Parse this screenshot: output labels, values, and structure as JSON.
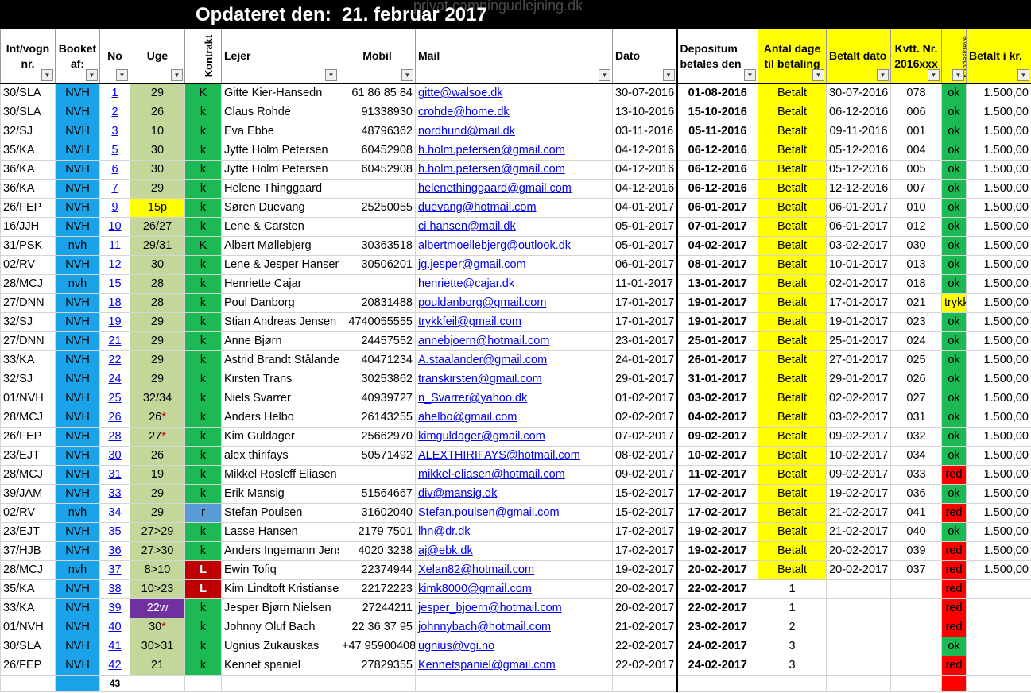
{
  "header": {
    "title": "Opdateret den:  21. februar 2017",
    "watermark": "privat.campingudlejning.dk"
  },
  "columns": {
    "int": "Int/vogn nr.",
    "booket": "Booket af:",
    "no": "No",
    "uge": "Uge",
    "kontrakt": "Kontrakt",
    "lejer": "Lejer",
    "mobil": "Mobil",
    "mail": "Mail",
    "dato": "Dato",
    "depositum": "Depositum betales den",
    "antal": "Antal dage til betaling",
    "betalt_dato": "Betalt dato",
    "kvtt": "Kvtt. Nr. 2016xxx",
    "kundeskreve": "Kundeskreve",
    "betalt_kr": "Betalt i kr."
  },
  "filter_icon": "dropdown-arrow-icon",
  "rows": [
    {
      "int": "30/SLA",
      "booket": "NVH",
      "no": "1",
      "uge": "29",
      "kontrakt": "K",
      "lejer": "Gitte Kier-Hansedn",
      "mobil": "61 86 85 84",
      "mail": "gitte@walsoe.dk",
      "dato": "30-07-2016",
      "depositum": "01-08-2016",
      "antal": "Betalt",
      "betalt_dato": "30-07-2016",
      "kvtt": "078",
      "status": "ok",
      "kr": "1.500,00"
    },
    {
      "int": "30/SLA",
      "booket": "NVH",
      "no": "2",
      "uge": "26",
      "kontrakt": "k",
      "lejer": "Claus Rohde",
      "mobil": "91338930",
      "mail": "crohde@home.dk",
      "dato": "13-10-2016",
      "depositum": "15-10-2016",
      "antal": "Betalt",
      "betalt_dato": "06-12-2016",
      "kvtt": "006",
      "status": "ok",
      "kr": "1.500,00"
    },
    {
      "int": "32/SJ",
      "booket": "NVH",
      "no": "3",
      "uge": "10",
      "kontrakt": "k",
      "lejer": "Eva Ebbe",
      "mobil": "48796362",
      "mail": "nordhund@mail.dk",
      "dato": "03-11-2016",
      "depositum": "05-11-2016",
      "antal": "Betalt",
      "betalt_dato": "09-11-2016",
      "kvtt": "001",
      "status": "ok",
      "kr": "1.500,00"
    },
    {
      "int": "35/KA",
      "booket": "NVH",
      "no": "5",
      "uge": "30",
      "kontrakt": "k",
      "lejer": "Jytte Holm Petersen",
      "mobil": "60452908",
      "mail": "h.holm.petersen@gmail.com",
      "dato": "04-12-2016",
      "depositum": "06-12-2016",
      "antal": "Betalt",
      "betalt_dato": "05-12-2016",
      "kvtt": "004",
      "status": "ok",
      "kr": "1.500,00"
    },
    {
      "int": "36/KA",
      "booket": "NVH",
      "no": "6",
      "uge": "30",
      "kontrakt": "k",
      "lejer": "Jytte Holm Petersen",
      "mobil": "60452908",
      "mail": "h.holm.petersen@gmail.com",
      "dato": "04-12-2016",
      "depositum": "06-12-2016",
      "antal": "Betalt",
      "betalt_dato": "05-12-2016",
      "kvtt": "005",
      "status": "ok",
      "kr": "1.500,00"
    },
    {
      "int": "36/KA",
      "booket": "NVH",
      "no": "7",
      "uge": "29",
      "kontrakt": "k",
      "lejer": "Helene Thinggaard",
      "mobil": "",
      "mail": "helenethinggaard@gmail.com",
      "dato": "04-12-2016",
      "depositum": "06-12-2016",
      "antal": "Betalt",
      "betalt_dato": "12-12-2016",
      "kvtt": "007",
      "status": "ok",
      "kr": "1.500,00"
    },
    {
      "int": "26/FEP",
      "booket": "NVH",
      "no": "9",
      "uge": "15p",
      "uge_style": "yellow",
      "kontrakt": "k",
      "lejer": "Søren Duevang",
      "mobil": "25250055",
      "mail": "duevang@hotmail.com",
      "dato": "04-01-2017",
      "depositum": "06-01-2017",
      "antal": "Betalt",
      "betalt_dato": "06-01-2017",
      "kvtt": "010",
      "status": "ok",
      "kr": "1.500,00"
    },
    {
      "int": "16/JJH",
      "booket": "NVH",
      "no": "10",
      "uge": "26/27",
      "kontrakt": "k",
      "lejer": "Lene & Carsten",
      "mobil": "",
      "mail": "ci.hansen@mail.dk",
      "dato": "05-01-2017",
      "depositum": "07-01-2017",
      "antal": "Betalt",
      "betalt_dato": "06-01-2017",
      "kvtt": "012",
      "status": "ok",
      "kr": "1.500,00"
    },
    {
      "int": "31/PSK",
      "booket": "nvh",
      "no": "11",
      "uge": "29/31",
      "kontrakt": "K",
      "lejer": "Albert Møllebjerg",
      "mobil": "30363518",
      "mail": "albertmoellebjerg@outlook.dk",
      "dato": "05-01-2017",
      "depositum": "04-02-2017",
      "antal": "Betalt",
      "betalt_dato": "03-02-2017",
      "kvtt": "030",
      "status": "ok",
      "kr": "1.500,00"
    },
    {
      "int": "02/RV",
      "booket": "NVH",
      "no": "12",
      "uge": "30",
      "kontrakt": "k",
      "lejer": "Lene & Jesper Hansen",
      "mobil": "30506201",
      "mail": "jg.jesper@gmail.com",
      "dato": "06-01-2017",
      "depositum": "08-01-2017",
      "antal": "Betalt",
      "betalt_dato": "10-01-2017",
      "kvtt": "013",
      "status": "ok",
      "kr": "1.500,00"
    },
    {
      "int": "28/MCJ",
      "booket": "nvh",
      "no": "15",
      "uge": "28",
      "kontrakt": "k",
      "lejer": "Henriette Cajar",
      "mobil": "",
      "mail": "henriette@cajar.dk",
      "dato": "11-01-2017",
      "depositum": "13-01-2017",
      "antal": "Betalt",
      "betalt_dato": "02-01-2017",
      "kvtt": "018",
      "status": "ok",
      "kr": "1.500,00"
    },
    {
      "int": "27/DNN",
      "booket": "NVH",
      "no": "18",
      "uge": "28",
      "kontrakt": "k",
      "lejer": "Poul Danborg",
      "mobil": "20831488",
      "mail": "pouldanborg@gmail.com",
      "dato": "17-01-2017",
      "depositum": "19-01-2017",
      "antal": "Betalt",
      "betalt_dato": "17-01-2017",
      "kvtt": "021",
      "status": "trykkeri",
      "kr": "1.500,00"
    },
    {
      "int": "32/SJ",
      "booket": "NVH",
      "no": "19",
      "uge": "29",
      "kontrakt": "k",
      "lejer": "Stian Andreas Jensen",
      "mobil": "4740055555",
      "mail": "trykkfeil@gmail.com",
      "dato": "17-01-2017",
      "depositum": "19-01-2017",
      "antal": "Betalt",
      "betalt_dato": "19-01-2017",
      "kvtt": "023",
      "status": "ok",
      "kr": "1.500,00"
    },
    {
      "int": "27/DNN",
      "booket": "NVH",
      "no": "21",
      "uge": "29",
      "kontrakt": "k",
      "lejer": "Anne Bjørn",
      "mobil": "24457552",
      "mail": "annebjoern@hotmail.com",
      "dato": "23-01-2017",
      "depositum": "25-01-2017",
      "antal": "Betalt",
      "betalt_dato": "25-01-2017",
      "kvtt": "024",
      "status": "ok",
      "kr": "1.500,00"
    },
    {
      "int": "33/KA",
      "booket": "NVH",
      "no": "22",
      "uge": "29",
      "kontrakt": "k",
      "lejer": "Astrid Brandt Stålande",
      "mobil": "40471234",
      "mail": "A.staalander@gmail.com",
      "dato": "24-01-2017",
      "depositum": "26-01-2017",
      "antal": "Betalt",
      "betalt_dato": "27-01-2017",
      "kvtt": "025",
      "status": "ok",
      "kr": "1.500,00"
    },
    {
      "int": "32/SJ",
      "booket": "NVH",
      "no": "24",
      "uge": "29",
      "kontrakt": "k",
      "lejer": "Kirsten Trans",
      "mobil": "30253862",
      "mail": "transkirsten@gmail.com",
      "dato": "29-01-2017",
      "depositum": "31-01-2017",
      "antal": "Betalt",
      "betalt_dato": "29-01-2017",
      "kvtt": "026",
      "status": "ok",
      "kr": "1.500,00"
    },
    {
      "int": "01/NVH",
      "booket": "NVH",
      "no": "25",
      "uge": "32/34",
      "kontrakt": "k",
      "lejer": "Niels Svarrer",
      "mobil": "40939727",
      "mail": "n_Svarrer@yahoo.dk",
      "dato": "01-02-2017",
      "depositum": "03-02-2017",
      "antal": "Betalt",
      "betalt_dato": "02-02-2017",
      "kvtt": "027",
      "status": "ok",
      "kr": "1.500,00"
    },
    {
      "int": "28/MCJ",
      "booket": "NVH",
      "no": "26",
      "uge": "26",
      "uge_star": "*",
      "kontrakt": "k",
      "lejer": "Anders Helbo",
      "mobil": "26143255",
      "mail": "ahelbo@gmail.com",
      "dato": "02-02-2017",
      "depositum": "04-02-2017",
      "antal": "Betalt",
      "betalt_dato": "03-02-2017",
      "kvtt": "031",
      "status": "ok",
      "kr": "1.500,00"
    },
    {
      "int": "26/FEP",
      "booket": "NVH",
      "no": "28",
      "uge": "27",
      "uge_star": "*",
      "kontrakt": "k",
      "lejer": "Kim Guldager",
      "mobil": "25662970",
      "mail": "kimguldager@gmail.com",
      "dato": "07-02-2017",
      "depositum": "09-02-2017",
      "antal": "Betalt",
      "betalt_dato": "09-02-2017",
      "kvtt": "032",
      "status": "ok",
      "kr": "1.500,00"
    },
    {
      "int": "23/EJT",
      "booket": "NVH",
      "no": "30",
      "uge": "26",
      "kontrakt": "k",
      "lejer": "alex thirifays",
      "mobil": "50571492",
      "mail": "ALEXTHIRIFAYS@hotmail.com",
      "dato": "08-02-2017",
      "depositum": "10-02-2017",
      "antal": "Betalt",
      "betalt_dato": "10-02-2017",
      "kvtt": "034",
      "status": "ok",
      "kr": "1.500,00"
    },
    {
      "int": "28/MCJ",
      "booket": "NVH",
      "no": "31",
      "uge": "19",
      "kontrakt": "k",
      "lejer": "Mikkel Rosleff Eliasen",
      "mobil": "",
      "mail": "mikkel-eliasen@hotmail.com",
      "dato": "09-02-2017",
      "depositum": "11-02-2017",
      "antal": "Betalt",
      "betalt_dato": "09-02-2017",
      "kvtt": "033",
      "status": "red",
      "kr": "1.500,00"
    },
    {
      "int": "39/JAM",
      "booket": "NVH",
      "no": "33",
      "uge": "29",
      "kontrakt": "k",
      "lejer": "Erik Mansig",
      "mobil": "51564667",
      "mail": "div@mansig.dk",
      "dato": "15-02-2017",
      "depositum": "17-02-2017",
      "antal": "Betalt",
      "betalt_dato": "19-02-2017",
      "kvtt": "036",
      "status": "ok",
      "kr": "1.500,00"
    },
    {
      "int": "02/RV",
      "booket": "nvh",
      "no": "34",
      "uge": "29",
      "kontrakt": "r",
      "kontrakt_style": "blue",
      "lejer": "Stefan Poulsen",
      "mobil": "31602040",
      "mail": "Stefan.poulsen@gmail.com",
      "dato": "15-02-2017",
      "depositum": "17-02-2017",
      "antal": "Betalt",
      "betalt_dato": "21-02-2017",
      "kvtt": "041",
      "status": "red",
      "kr": "1.500,00"
    },
    {
      "int": "23/EJT",
      "booket": "NVH",
      "no": "35",
      "uge": "27>29",
      "kontrakt": "k",
      "lejer": "Lasse Hansen",
      "mobil": "2179 7501",
      "mail": "lhn@dr.dk",
      "dato": "17-02-2017",
      "depositum": "19-02-2017",
      "antal": "Betalt",
      "betalt_dato": "21-02-2017",
      "kvtt": "040",
      "status": "ok",
      "kr": "1.500,00"
    },
    {
      "int": "37/HJB",
      "booket": "NVH",
      "no": "36",
      "uge": "27>30",
      "kontrakt": "k",
      "lejer": "Anders Ingemann Jens",
      "mobil": "4020 3238",
      "mail": "aj@ebk.dk",
      "dato": "17-02-2017",
      "depositum": "19-02-2017",
      "antal": "Betalt",
      "betalt_dato": "20-02-2017",
      "kvtt": "039",
      "status": "red",
      "kr": "1.500,00"
    },
    {
      "int": "28/MCJ",
      "booket": "nvh",
      "no": "37",
      "uge": "8>10",
      "kontrakt": "L",
      "kontrakt_style": "red",
      "lejer": "Ewin Tofiq",
      "mobil": "22374944",
      "mail": "Xelan82@hotmail.com",
      "dato": "19-02-2017",
      "depositum": "20-02-2017",
      "antal": "Betalt",
      "betalt_dato": "20-02-2017",
      "kvtt": "037",
      "status": "red",
      "kr": "1.500,00"
    },
    {
      "int": "35/KA",
      "booket": "NVH",
      "no": "38",
      "uge": "10>23",
      "kontrakt": "L",
      "kontrakt_style": "red",
      "lejer": "Kim Lindtoft Kristianse",
      "mobil": "22172223",
      "mail": "kimk8000@gmail.com",
      "dato": "20-02-2017",
      "depositum": "22-02-2017",
      "antal": "1",
      "betalt_dato": "",
      "kvtt": "",
      "status": "red",
      "kr": ""
    },
    {
      "int": "33/KA",
      "booket": "NVH",
      "no": "39",
      "uge": "22w",
      "uge_style": "purple",
      "kontrakt": "k",
      "lejer": "Jesper Bjørn Nielsen",
      "mobil": "27244211",
      "mail": "jesper_bjoern@hotmail.com",
      "dato": "20-02-2017",
      "depositum": "22-02-2017",
      "antal": "1",
      "betalt_dato": "",
      "kvtt": "",
      "status": "red",
      "kr": ""
    },
    {
      "int": "01/NVH",
      "booket": "NVH",
      "no": "40",
      "uge": "30",
      "uge_star": "*",
      "kontrakt": "k",
      "lejer": "Johnny Oluf Bach",
      "mobil": "22 36 37 95",
      "mail": "johnnybach@hotmail.com",
      "dato": "21-02-2017",
      "depositum": "23-02-2017",
      "antal": "2",
      "betalt_dato": "",
      "kvtt": "",
      "status": "red",
      "kr": ""
    },
    {
      "int": "30/SLA",
      "booket": "NVH",
      "no": "41",
      "uge": "30>31",
      "kontrakt": "k",
      "lejer": "Ugnius Zukauskas",
      "mobil": "+47 95900408",
      "mail": "ugnius@vgi.no",
      "dato": "22-02-2017",
      "depositum": "24-02-2017",
      "antal": "3",
      "betalt_dato": "",
      "kvtt": "",
      "status": "ok",
      "kr": ""
    },
    {
      "int": "26/FEP",
      "booket": "NVH",
      "no": "42",
      "uge": "21",
      "kontrakt": "k",
      "lejer": "Kennet spaniel",
      "mobil": "27829355",
      "mail": "Kennetspaniel@gmail.com",
      "dato": "22-02-2017",
      "depositum": "24-02-2017",
      "antal": "3",
      "betalt_dato": "",
      "kvtt": "",
      "status": "red",
      "kr": ""
    }
  ],
  "summary": {
    "count": "43"
  },
  "colors": {
    "booket": "#1aa3e8",
    "uge": "#c4d79b",
    "kontrakt_green": "#1db954",
    "betaling_yellow": "#ffff00",
    "status_red": "#ff0000"
  }
}
